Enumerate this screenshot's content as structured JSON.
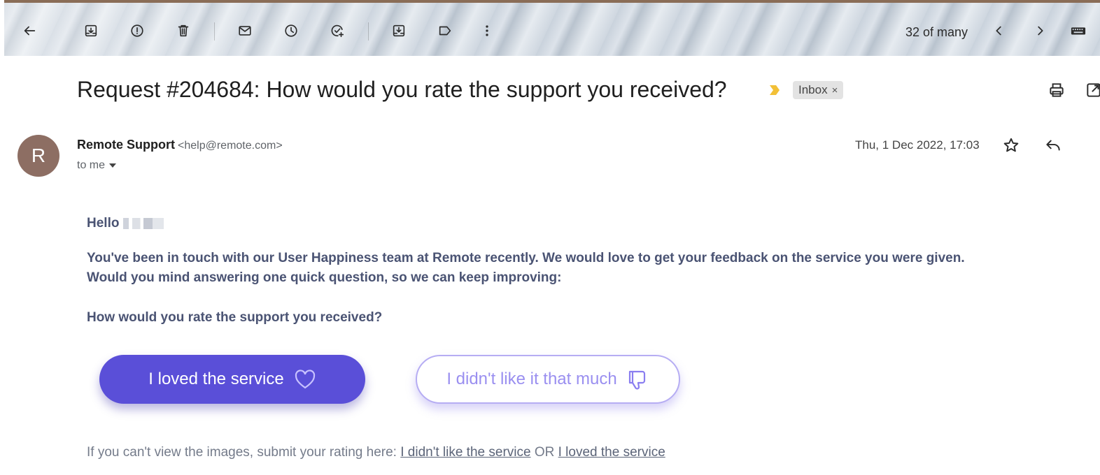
{
  "toolbar": {
    "icons": [
      "back-arrow-icon",
      "archive-icon",
      "report-spam-icon",
      "delete-icon",
      "mark-unread-icon",
      "snooze-icon",
      "add-to-tasks-icon",
      "move-to-icon",
      "label-icon",
      "more-options-icon"
    ],
    "pager_text": "32 of many",
    "nav_icons": [
      "prev-chevron-icon",
      "next-chevron-icon",
      "keyboard-icon"
    ]
  },
  "email": {
    "subject": "Request #204684: How would you rate the support you received?",
    "label_chip": "Inbox",
    "label_remove": "×",
    "sender": {
      "avatar_letter": "R",
      "avatar_color": "#8d6e63",
      "name": "Remote Support",
      "email": "<help@remote.com>",
      "to": "to me"
    },
    "date": "Thu, 1 Dec 2022, 17:03",
    "body": {
      "greeting": "Hello",
      "paragraph_line1": "You've been in touch with our User Happiness team at Remote recently. We would love to get your feedback on the service you were given.",
      "paragraph_line2": "Would you mind answering one quick question, so we can keep improving:",
      "question": "How would you rate the support you received?",
      "loved_button": "I loved the service",
      "disliked_button": "I didn't like it that much",
      "fallback_prefix": "If you can't view the images, submit your rating here:",
      "fallback_link_dislike": "I didn't like the service",
      "fallback_or": "OR",
      "fallback_link_love": "I loved the service"
    }
  },
  "colors": {
    "primary_button": "#5a4fd8",
    "secondary_button_text": "#9a8ff0",
    "body_text": "#4a5373",
    "importance_marker": "#f2c037"
  }
}
